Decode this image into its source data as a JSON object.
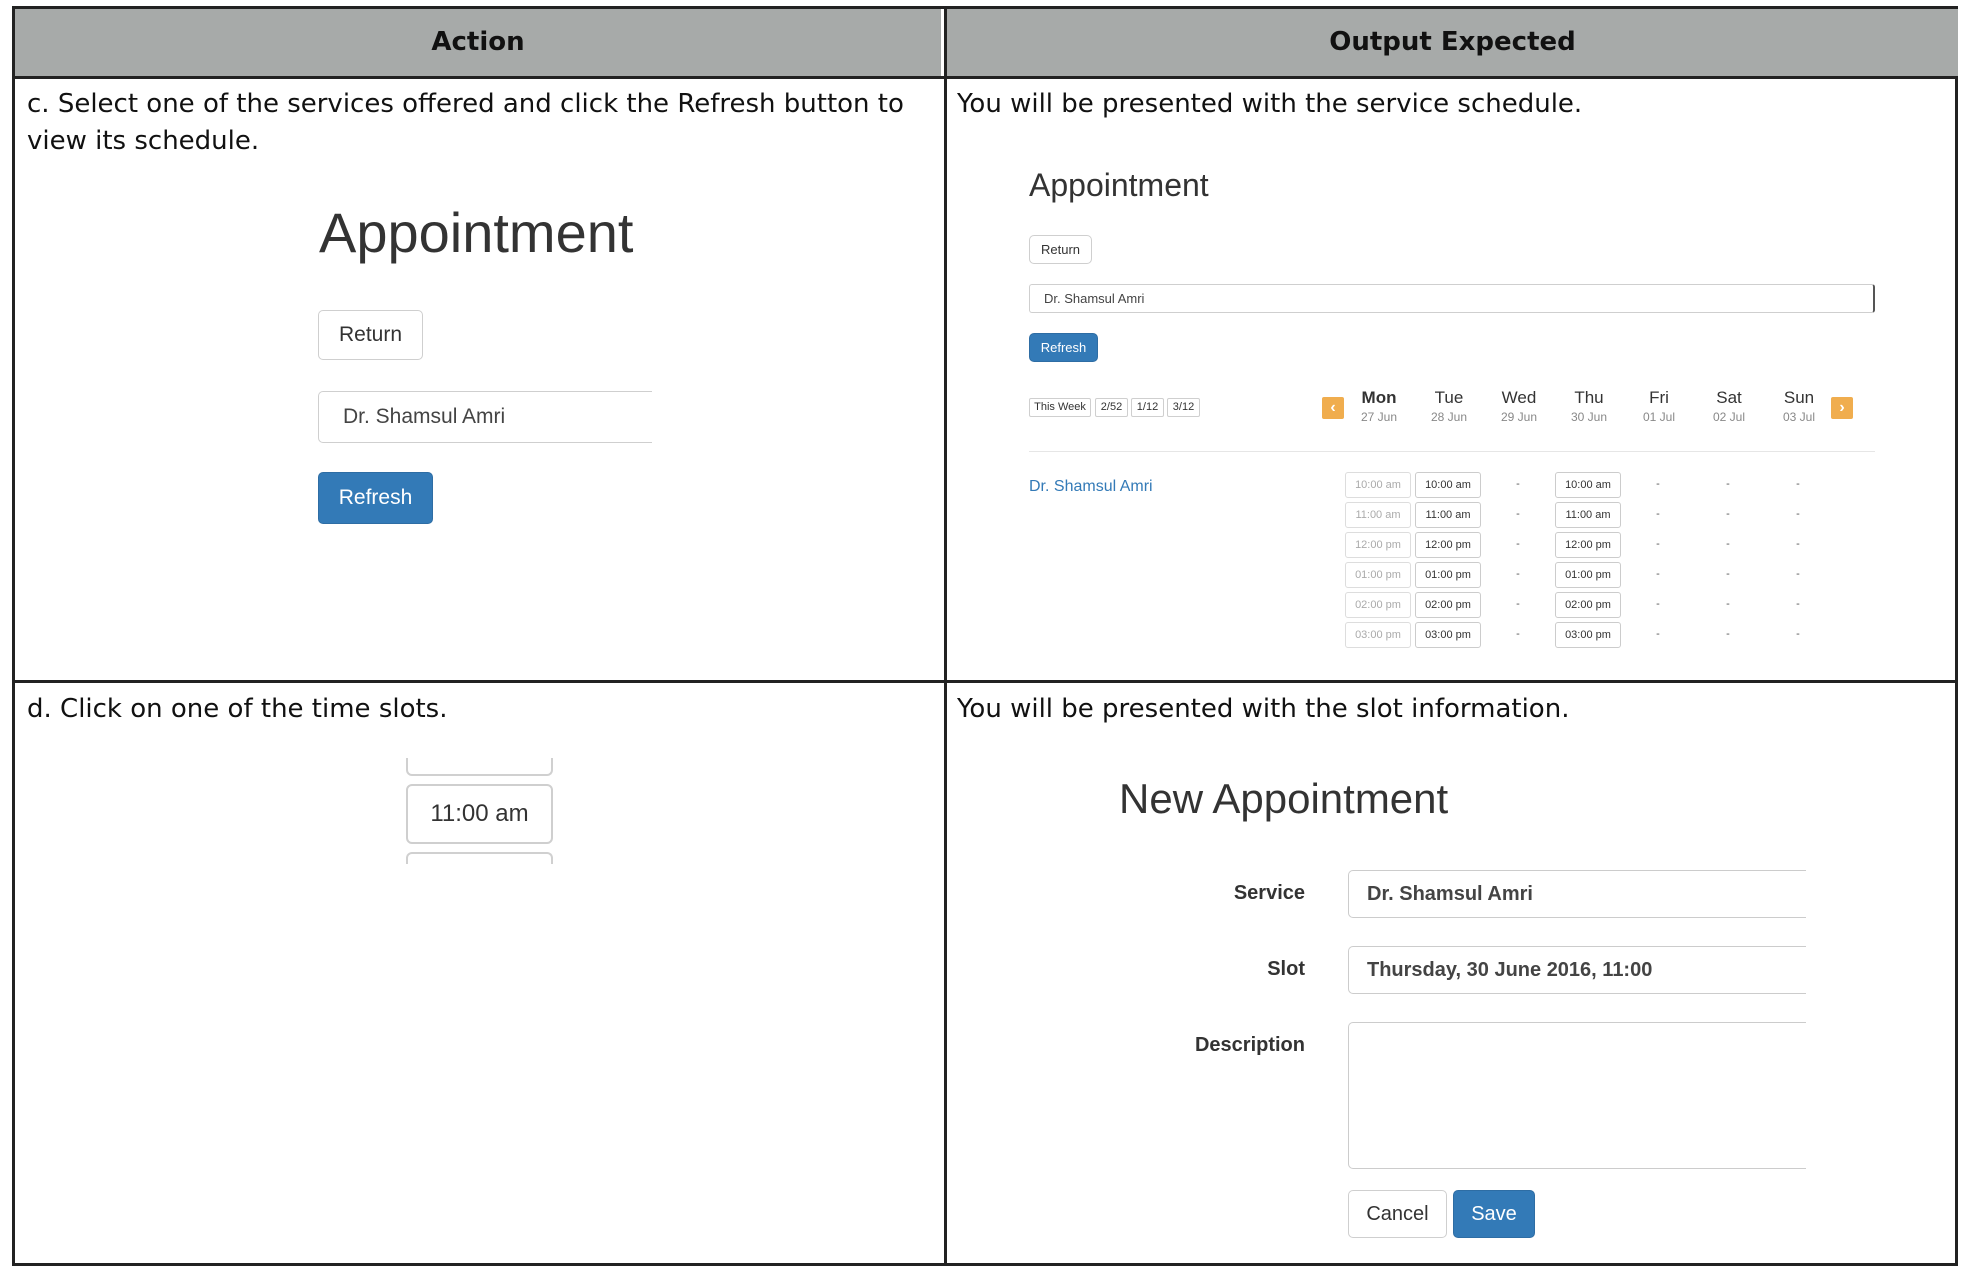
{
  "table": {
    "col_action": "Action",
    "col_output": "Output Expected"
  },
  "row_c": {
    "action_text": "c. Select one of the services offered and click the Refresh button to view its schedule.",
    "output_text": "You will be presented with the service schedule.",
    "shot": {
      "title": "Appointment",
      "return_label": "Return",
      "service_value": "Dr. Shamsul Amri",
      "refresh_label": "Refresh"
    },
    "schedule": {
      "title": "Appointment",
      "return_label": "Return",
      "service_value": "Dr. Shamsul Amri",
      "refresh_label": "Refresh",
      "range_buttons": [
        "This Week",
        "2/52",
        "1/12",
        "3/12"
      ],
      "days": [
        {
          "name": "Mon",
          "date": "27 Jun"
        },
        {
          "name": "Tue",
          "date": "28 Jun"
        },
        {
          "name": "Wed",
          "date": "29 Jun"
        },
        {
          "name": "Thu",
          "date": "30 Jun"
        },
        {
          "name": "Fri",
          "date": "01 Jul"
        },
        {
          "name": "Sat",
          "date": "02 Jul"
        },
        {
          "name": "Sun",
          "date": "03 Jul"
        }
      ],
      "prev_icon": "chevron-left-icon",
      "next_icon": "chevron-right-icon",
      "provider": "Dr. Shamsul Amri",
      "times": [
        "10:00 am",
        "11:00 am",
        "12:00 pm",
        "01:00 pm",
        "02:00 pm",
        "03:00 pm"
      ],
      "empty_mark": "-"
    }
  },
  "row_d": {
    "action_text": "d. Click on one of the time slots.",
    "output_text": "You will be presented with the slot information.",
    "slot_label": "11:00 am",
    "form": {
      "title": "New Appointment",
      "service_label": "Service",
      "service_value": "Dr. Shamsul Amri",
      "slot_label": "Slot",
      "slot_value": "Thursday, 30 June 2016, 11:00",
      "description_label": "Description",
      "description_value": "",
      "cancel_label": "Cancel",
      "save_label": "Save"
    }
  },
  "colors": {
    "header_bg": "#a7aaa9",
    "primary": "#337ab7",
    "link": "#337ab7",
    "nav_accent": "#f0ad4e"
  }
}
